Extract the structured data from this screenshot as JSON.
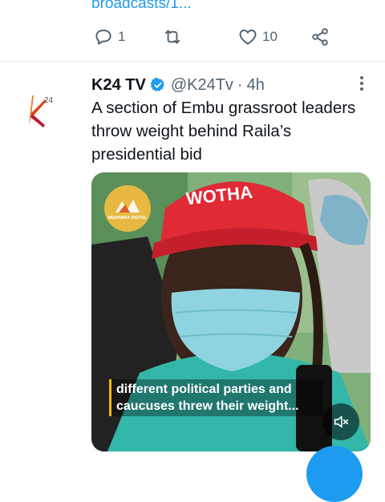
{
  "previous_tweet": {
    "link_text": "broadcasts/1...",
    "actions": {
      "reply_count": "1",
      "retweet_count": "",
      "like_count": "10"
    }
  },
  "tweet": {
    "name": "K24 TV",
    "handle": "@K24Tv",
    "separator": "·",
    "time": "4h",
    "text": "A section of Embu grassroot leaders throw weight behind Raila’s presidential bid",
    "media": {
      "cap_text": "WOTHA",
      "watermark_text": "MEDIAMAX DIGITAL",
      "caption_line1": "different political parties and",
      "caption_line2": "caucuses threw their weight..."
    }
  },
  "colors": {
    "accent": "#1d9bf0",
    "secondary_text": "#536471",
    "avatar_orange": "#e8731f",
    "avatar_red": "#c0182c"
  },
  "icons": [
    "reply-icon",
    "retweet-icon",
    "like-icon",
    "share-icon",
    "verified-icon",
    "more-icon",
    "mute-icon"
  ]
}
